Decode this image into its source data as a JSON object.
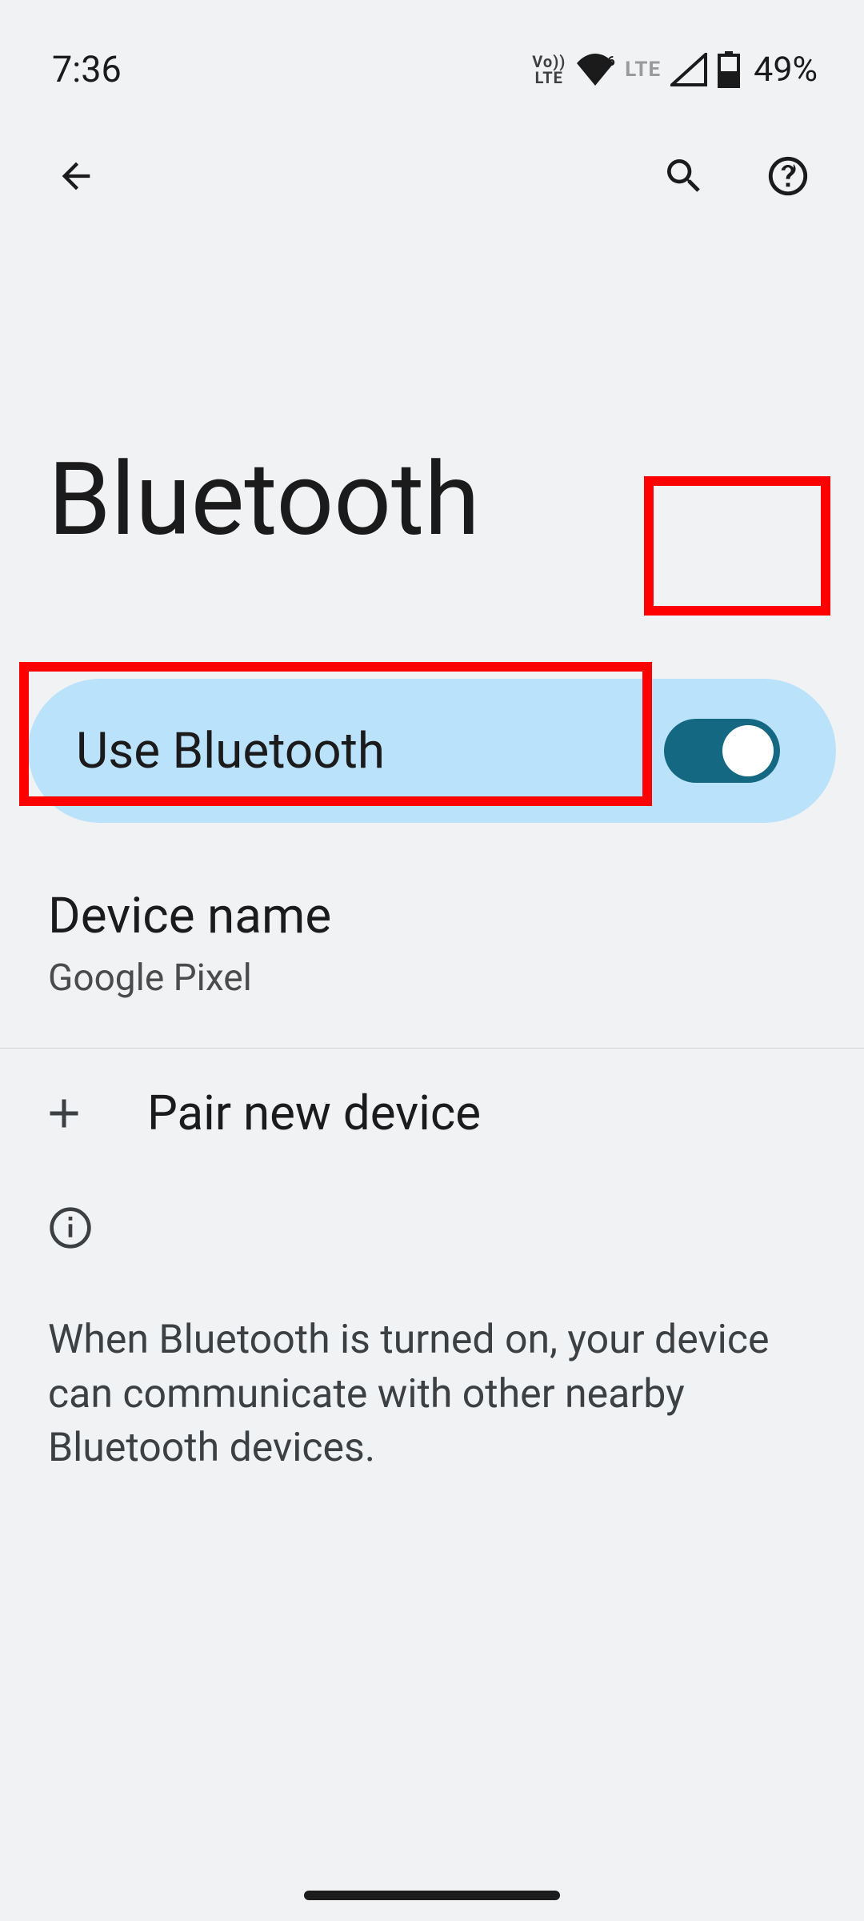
{
  "status": {
    "time": "7:36",
    "volte": "Vo\nLTE",
    "lte": "LTE",
    "battery": "49%"
  },
  "page": {
    "title": "Bluetooth"
  },
  "toggle": {
    "label": "Use Bluetooth",
    "enabled": true
  },
  "device_name_row": {
    "title": "Device name",
    "value": "Google Pixel"
  },
  "pair_row": {
    "label": "Pair new device"
  },
  "info": {
    "text": "When Bluetooth is turned on, your device can communicate with other nearby Bluetooth devices."
  }
}
